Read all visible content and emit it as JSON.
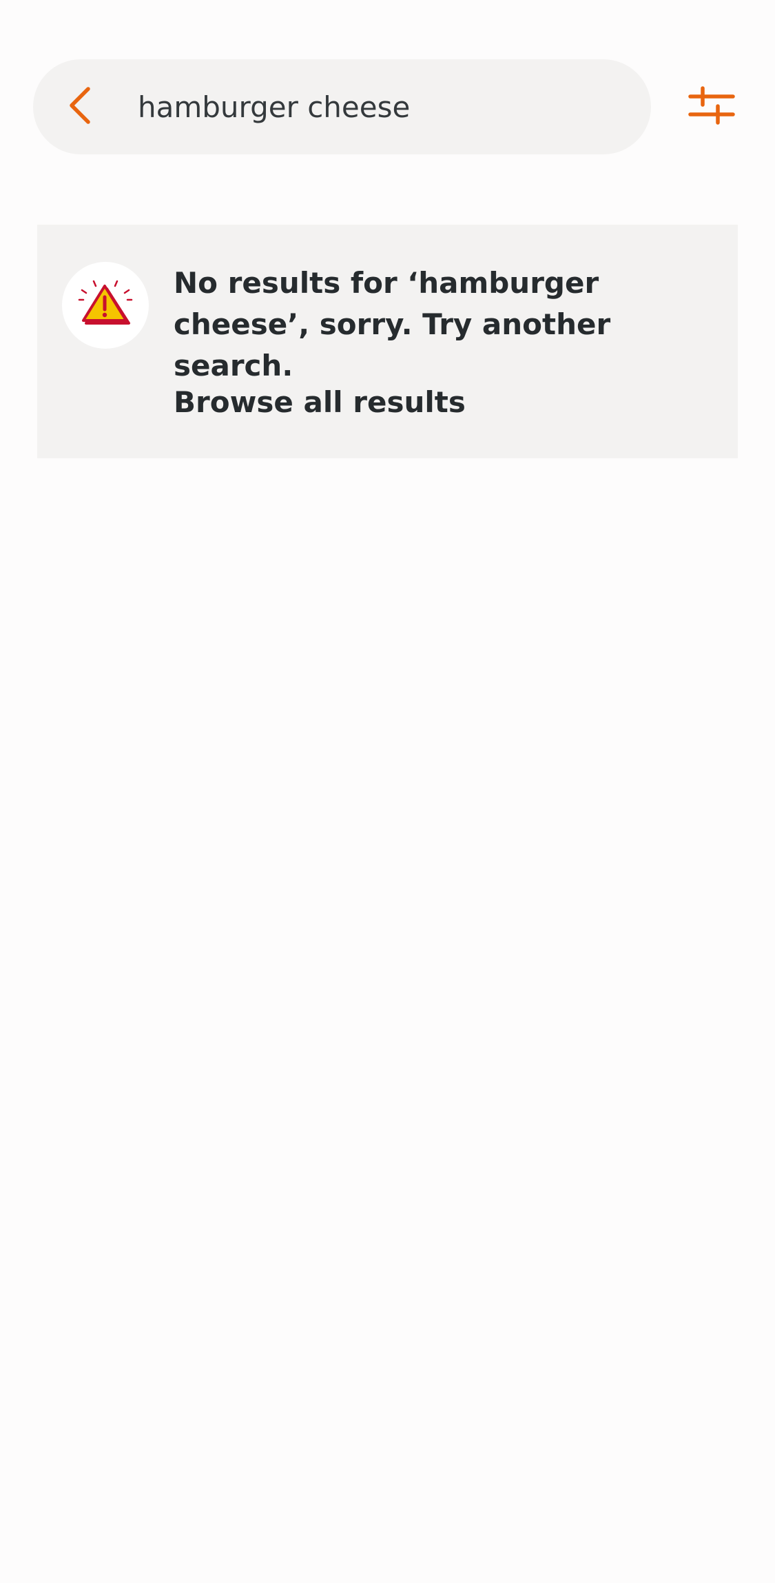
{
  "search": {
    "query": "hamburger cheese",
    "back_icon": "chevron-left-icon",
    "filter_icon": "sliders-icon"
  },
  "notice": {
    "icon": "warning-triangle-icon",
    "message": "No results for ‘hamburger cheese’, sorry. Try another search.",
    "browse_label": "Browse all results"
  },
  "colors": {
    "accent": "#e8650f",
    "panel": "#f3f2f1",
    "text": "#262b2e",
    "warning_fill": "#f5c400",
    "warning_stroke": "#c8102e"
  }
}
